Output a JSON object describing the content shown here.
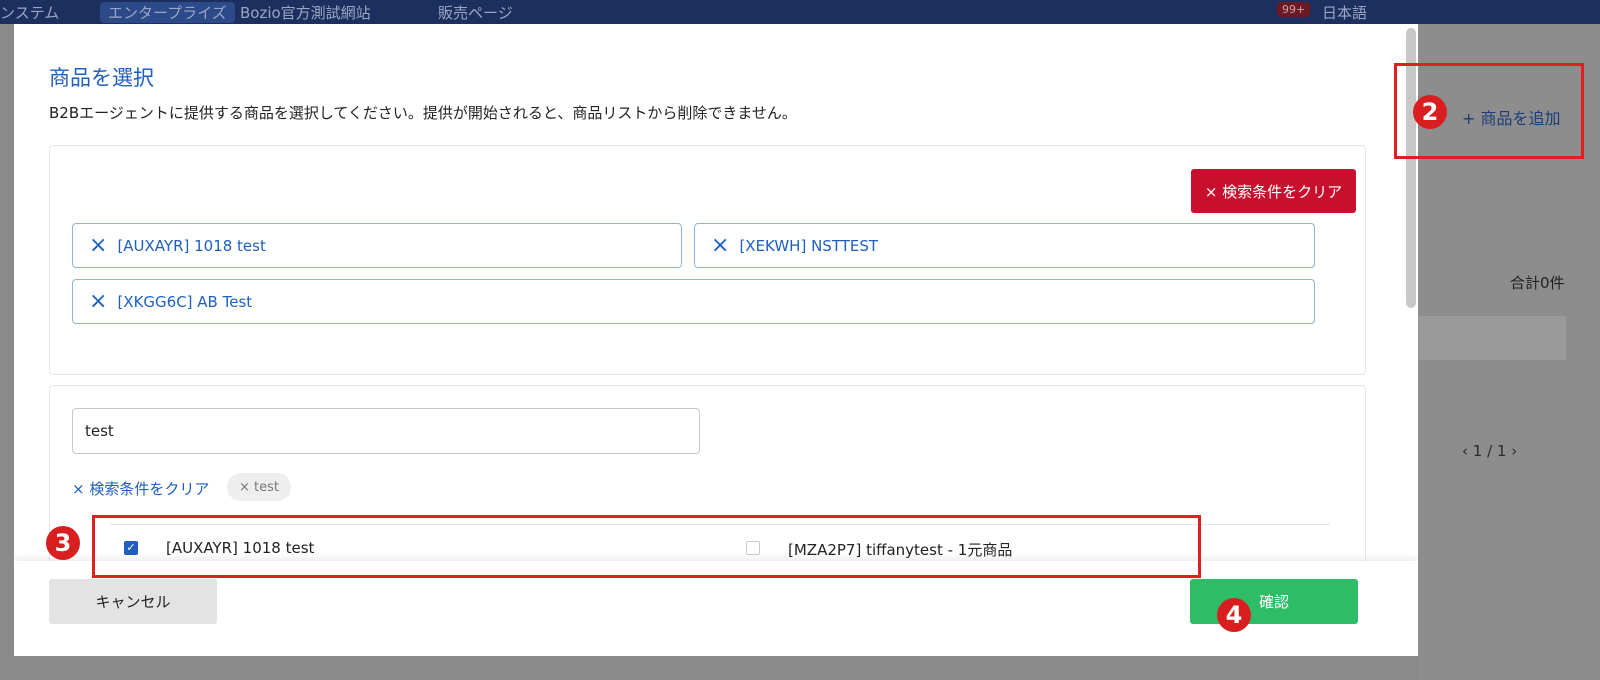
{
  "topbar": {
    "app_fragment": "ンステム",
    "plan_badge": "エンタープライズ",
    "shop_name": "Bozio官方測試網站",
    "sales_page": "販売ページ",
    "notifications": "99+",
    "language": "日本語"
  },
  "background": {
    "add_product": "+ 商品を追加",
    "total": "合計0件",
    "pager": "‹  1 / 1  ›"
  },
  "modal": {
    "title": "商品を選択",
    "description": "B2Bエージェントに提供する商品を選択してください。提供が開始されると、商品リストから削除できません。",
    "clear_filters_button": "× 検索条件をクリア",
    "selected_chips": [
      {
        "label": "[AUXAYR] 1018 test"
      },
      {
        "label": "[XEKWH] NSTTEST"
      },
      {
        "label": "[XKGG6C] AB Test"
      }
    ],
    "search": {
      "value": "test",
      "clear_link": "× 検索条件をクリア",
      "active_tag": "× test"
    },
    "results": [
      {
        "label": "[AUXAYR] 1018 test",
        "checked": true
      },
      {
        "label": "[MZA2P7] tiffanytest - 1元商品",
        "checked": false
      }
    ],
    "cancel_button": "キャンセル",
    "confirm_button": "確認"
  },
  "annotations": {
    "step2": "2",
    "step3": "3",
    "step4": "4",
    "color": "#e02020"
  },
  "colors": {
    "accent": "#1f5fbf",
    "danger": "#c8102e",
    "confirm": "#2ebd66",
    "topbar": "#1d2f5e"
  }
}
